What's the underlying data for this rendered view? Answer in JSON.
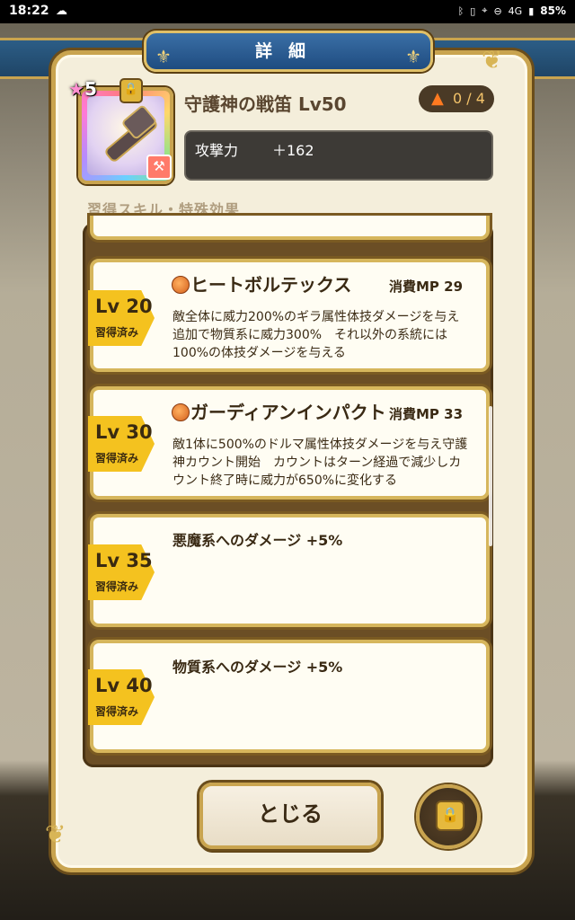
{
  "status_bar": {
    "time": "18:22",
    "battery": "85%",
    "network": "4G"
  },
  "dialog": {
    "title": "詳細"
  },
  "item": {
    "rank": "5",
    "name": "守護神の戦笛 Lv50",
    "upgrade": "0 / 4",
    "stat_label": "攻撃力",
    "stat_value": "＋162"
  },
  "section_label": "習得スキル・特殊効果",
  "skills": [
    {
      "level": "Lv 20",
      "learned": "習得済み",
      "name": "ヒートボルテックス",
      "mp": "消費MP 29",
      "desc": "敵全体に威力200%のギラ属性体技ダメージを与え　追加で物質系に威力300%　それ以外の系統には　100%の体技ダメージを与える"
    },
    {
      "level": "Lv 30",
      "learned": "習得済み",
      "name": "ガーディアンインパクト",
      "mp": "消費MP 33",
      "desc": "敵1体に500%のドルマ属性体技ダメージを与え守護神カウント開始　カウントはターン経過で減少しカウント終了時に威力が650%に変化する"
    },
    {
      "level": "Lv 35",
      "learned": "習得済み",
      "effect": "悪魔系へのダメージ +5%"
    },
    {
      "level": "Lv 40",
      "learned": "習得済み",
      "effect": "物質系へのダメージ +5%"
    }
  ],
  "buttons": {
    "close": "とじる"
  }
}
